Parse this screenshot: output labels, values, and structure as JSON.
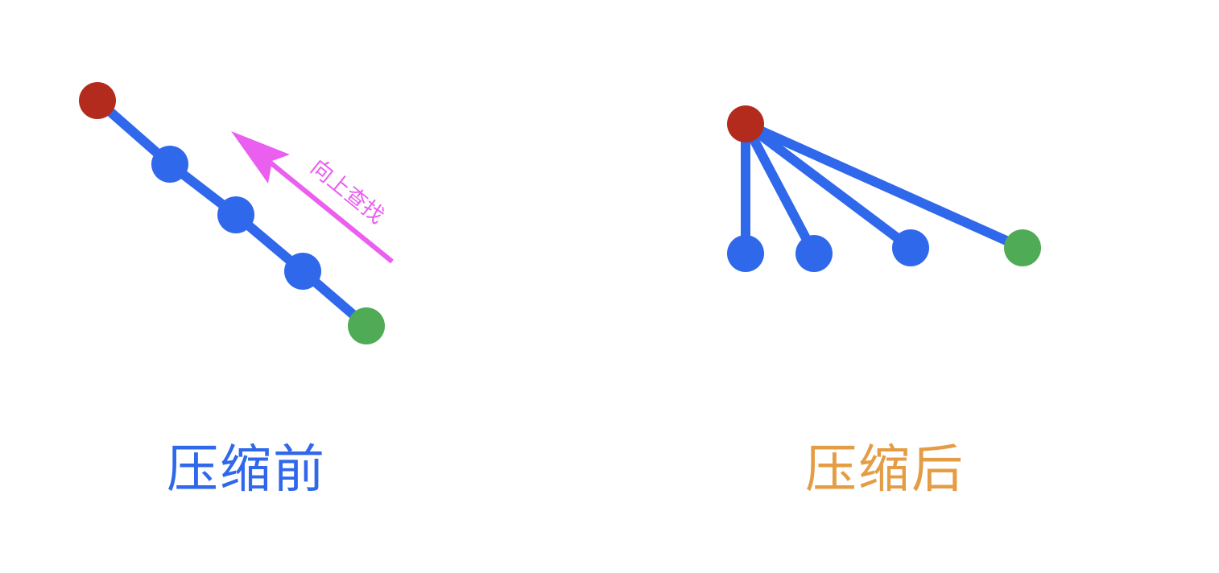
{
  "colors": {
    "root_node": "#b22b1d",
    "intermediate_node": "#2f68ea",
    "edge": "#2f68ea",
    "target_node": "#4fab56",
    "search_arrow": "#ea5ef0",
    "caption_before": "#2f68ea",
    "caption_after": "#e59d45"
  },
  "before": {
    "caption": "压缩前",
    "search_label": "向上查找"
  },
  "after": {
    "caption": "压缩后"
  }
}
